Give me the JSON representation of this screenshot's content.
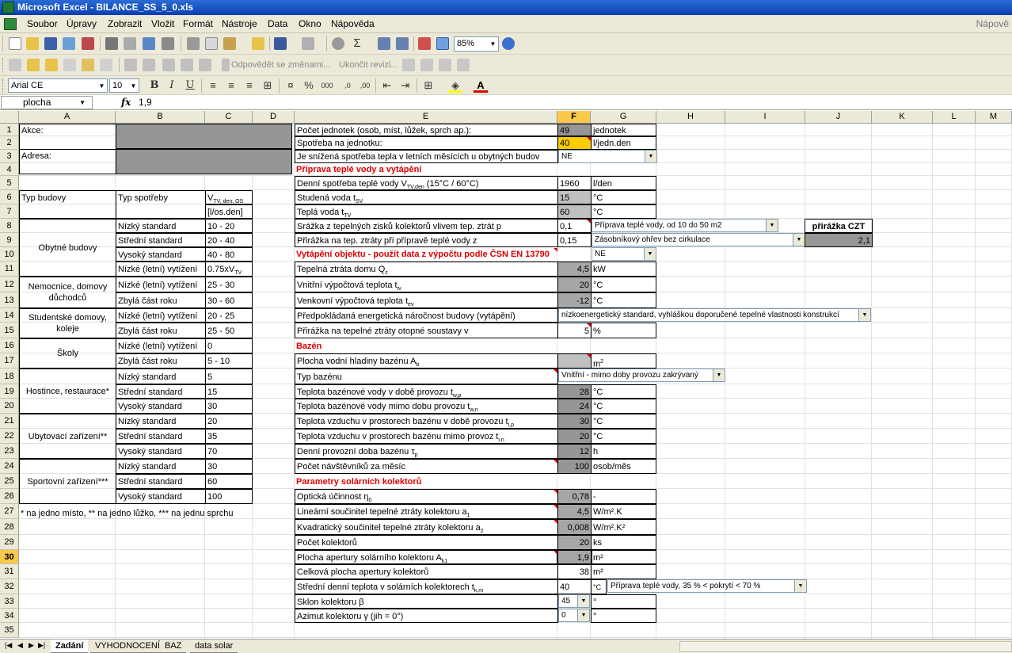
{
  "window": {
    "title": "Microsoft Excel - BILANCE_SS_5_0.xls"
  },
  "menu": {
    "items": [
      "Soubor",
      "Úpravy",
      "Zobrazit",
      "Vložit",
      "Formát",
      "Nástroje",
      "Data",
      "Okno",
      "Nápověda"
    ],
    "help_placeholder": "Nápově"
  },
  "toolbar": {
    "zoom": "85%",
    "review_reply": "Odpovědět se změnami...",
    "end_review": "Ukončit revizi...",
    "font_name": "Arial CE",
    "font_size": "10"
  },
  "formula_bar": {
    "name_box": "plocha",
    "fx": "fx",
    "value": "1,9"
  },
  "columns": [
    "A",
    "B",
    "C",
    "D",
    "E",
    "F",
    "G",
    "H",
    "I",
    "J",
    "K",
    "L",
    "M"
  ],
  "selected_column": "F",
  "rows": [
    "1",
    "2",
    "3",
    "4",
    "5",
    "6",
    "7",
    "8",
    "9",
    "10",
    "11",
    "12",
    "13",
    "14",
    "15",
    "16",
    "17",
    "18",
    "19",
    "20",
    "21",
    "22",
    "23",
    "24",
    "25",
    "26",
    "27",
    "28",
    "29",
    "30",
    "31",
    "32",
    "33",
    "34",
    "35"
  ],
  "selected_row": "30",
  "left_panel": {
    "akce": "Akce:",
    "adresa": "Adresa:",
    "hdr_typ_budovy": "Typ budovy",
    "hdr_typ_spotreby": "Typ spotřeby",
    "hdr_v": "V",
    "hdr_v_sub": "TV, den, OS",
    "hdr_unit": "[l/os.den]",
    "groups": [
      {
        "name": "Obytné budovy"
      },
      {
        "name": "Nemocnice, domovy důchodců"
      },
      {
        "name": "Studentské domovy, koleje"
      },
      {
        "name": "Školy"
      },
      {
        "name": "Hostince, restaurace*"
      },
      {
        "name": "Ubytovací zařízení**"
      },
      {
        "name": "Sportovní zařízení***"
      }
    ],
    "types": [
      "Nízký standard",
      "Střední standard",
      "Vysoký standard",
      "Nízké (letní) vytížení",
      "Nízké (letní) vytížení",
      "Zbylá část roku",
      "Nízké (letní) vytížení",
      "Zbylá část roku",
      "Nízké (letní) vytížení",
      "Zbylá část roku",
      "Nízký standard",
      "Střední standard",
      "Vysoký standard",
      "Nízký standard",
      "Střední standard",
      "Vysoký standard",
      "Nízký standard",
      "Střední standard",
      "Vysoký standard"
    ],
    "values": [
      "10 - 20",
      "20 - 40",
      "40 - 80",
      "0.75xV",
      "25 - 30",
      "30 - 60",
      "20 - 25",
      "25 - 50",
      "0",
      "5 - 10",
      "5",
      "15",
      "30",
      "20",
      "35",
      "70",
      "30",
      "60",
      "100"
    ],
    "value_sub_11": "TV",
    "footnote": "* na jedno místo, ** na jedno lůžko, *** na jednu sprchu"
  },
  "main": {
    "r1_label": "Počet jednotek (osob, míst, lůžek, sprch ap.):",
    "r1_val": "49",
    "r1_unit": "jednotek",
    "r2_label": "Spotřeba na jednotku:",
    "r2_val": "40",
    "r2_unit": "l/jedn.den",
    "r3_label": "Je snížená spotřeba tepla v letních měsících u obytných budov",
    "r3_select": "NE",
    "sec1": "Příprava teplé vody a vytápění",
    "r6_label": "Denní spotřeba teplé vody V",
    "r6_sub": "TV,den",
    "r6_tail": " (15°C / 60°C)",
    "r6_val": "1960",
    "r6_unit": "l/den",
    "r7_label": "Studená voda t",
    "r7_sub": "SV",
    "r7_val": "15",
    "r7_unit": "°C",
    "r8_label": "Teplá voda t",
    "r8_sub": "TV",
    "r8_val": "60",
    "r8_unit": "°C",
    "r9_label": "Srážka z tepelných zisků kolektorů vlivem tep. ztrát p",
    "r9_val": "0,1",
    "r9_select": "Příprava teplé vody, od 10 do 50 m2",
    "r10_label": "Přirážka na tep. ztráty při přípravě teplé vody z",
    "r10_val": "0,15",
    "r10_select": "Zásobníkový ohřev bez cirkulace",
    "czt_label": "přirážka CZT",
    "czt_val": "2,1",
    "sec2": "Vytápění objektu - použít data z výpočtu podle ČSN EN 13790",
    "sec2_select": "NE",
    "r11_label": "Tepelná ztráta domu Q",
    "r11_sub": "z",
    "r11_val": "4,5",
    "r11_unit": "kW",
    "r12_label": "Vnitřní výpočtová teplota t",
    "r12_sub": "iv",
    "r12_val": "20",
    "r12_unit": "°C",
    "r13_label": "Venkovní výpočtová teplota t",
    "r13_sub": "ev",
    "r13_val": "-12",
    "r13_unit": "°C",
    "r14_label": "Předpokládaná energetická náročnost budovy (vytápění)",
    "r14_select": "nízkoenergetický standard, vyhláškou doporučené tepelné vlastnosti konstrukcí",
    "r15_label": "Přirážka na tepelné ztráty otopné soustavy v",
    "r15_val": "5",
    "r15_unit": "%",
    "sec3": "Bazén",
    "r17_label": "Plocha vodní hladiny bazénu A",
    "r17_sub": "b",
    "r17_val": "",
    "r17_unit": "m",
    "r18_label": "Typ bazénu",
    "r18_select": "Vnitřní - mimo doby provozu zakrývaný",
    "r19_label": "Teplota bazénové vody  v době provozu t",
    "r19_sub": "w,p",
    "r19_val": "28",
    "r19_unit": "°C",
    "r20_label": "Teplota bazénové vody mimo dobu provozu t",
    "r20_sub": "w,n",
    "r20_val": "24",
    "r20_unit": "°C",
    "r21_label": "Teplota vzduchu v prostorech bazénu v době provozu   t",
    "r21_sub": "i,p",
    "r21_val": "30",
    "r21_unit": "°C",
    "r22_label": "Teplota vzduchu v prostorech bazénu mimo provoz   t",
    "r22_sub": "i,n",
    "r22_val": "20",
    "r22_unit": "°C",
    "r23_label": "Denní provozní doba bazénu τ",
    "r23_sub": "p",
    "r23_val": "12",
    "r23_unit": "h",
    "r24_label": "Počet návštěvníků za měsíc",
    "r24_val": "100",
    "r24_unit": "osob/měs",
    "sec4": "Parametry solárních kolektorů",
    "r26_label": "Optická účinnost η",
    "r26_sub": "0",
    "r26_val": "0,78",
    "r26_unit": "-",
    "r27_label": "Lineární součinitel tepelné ztráty kolektoru a",
    "r27_sub": "1",
    "r27_val": "4,5",
    "r27_unit": "W/m².K",
    "r28_label": "Kvadratický součinitel tepelné ztráty kolektoru a",
    "r28_sub": "2",
    "r28_val": "0,008",
    "r28_unit": "W/m².K²",
    "r29_label": "Počet kolektorů",
    "r29_val": "20",
    "r29_unit": "ks",
    "r30_label": "Plocha apertury solárního kolektoru A",
    "r30_sub": "k1",
    "r30_val": "1,9",
    "r30_unit": "m²",
    "r31_label": "Celková plocha apertury kolektorů",
    "r31_val": "38",
    "r31_unit": "m²",
    "r32_label": "Střední denní teplota v solárních kolektorech t",
    "r32_sub": "k,m",
    "r32_val": "40",
    "r32_unit": "°C",
    "r32_select": "Příprava teplé vody, 35 % < pokrytí < 70 %",
    "r33_label": "Sklon kolektoru β",
    "r33_select": "45",
    "r33_unit": "°",
    "r34_label": "Azimut kolektoru γ (jih = 0°)",
    "r34_select": "0",
    "r34_unit": "°",
    "r17_unit_sup": "2"
  },
  "sheets": {
    "tabs": [
      "Zadání",
      "VYHODNOCENÍ",
      "BAZ",
      "data solar"
    ],
    "active": "Zadání"
  }
}
